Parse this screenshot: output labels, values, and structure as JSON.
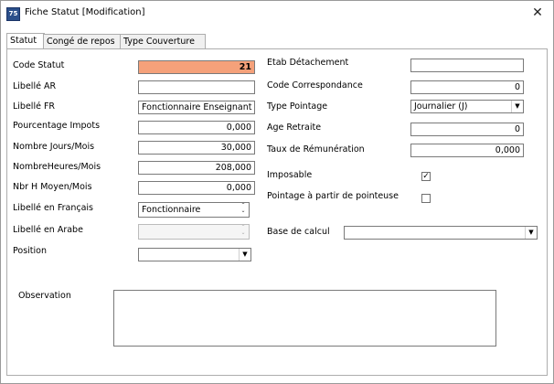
{
  "window": {
    "title": "Fiche Statut [Modification]",
    "icon_text": "75"
  },
  "tabs": [
    "Statut",
    "Congé de repos",
    "Type Couverture"
  ],
  "left": {
    "code_statut": {
      "label": "Code Statut",
      "value": "21"
    },
    "libelle_ar": {
      "label": "Libellé AR",
      "value": ""
    },
    "libelle_fr": {
      "label": "Libellé FR",
      "value": "Fonctionnaire Enseignant"
    },
    "pourcentage_impots": {
      "label": "Pourcentage Impots",
      "value": "0,000"
    },
    "nombre_jours_mois": {
      "label": "Nombre Jours/Mois",
      "value": "30,000"
    },
    "nombre_heures_mois": {
      "label": "NombreHeures/Mois",
      "value": "208,000"
    },
    "nbr_h_moyen_mois": {
      "label": "Nbr H Moyen/Mois",
      "value": "0,000"
    },
    "libelle_en_francais": {
      "label": "Libellé en Français",
      "value": "Fonctionnaire"
    },
    "libelle_en_arabe": {
      "label": "Libellé en Arabe",
      "value": ""
    },
    "position": {
      "label": "Position",
      "value": ""
    }
  },
  "right": {
    "etab_detachement": {
      "label": "Etab Détachement",
      "value": ""
    },
    "code_correspondance": {
      "label": "Code Correspondance",
      "value": "0"
    },
    "type_pointage": {
      "label": "Type Pointage",
      "value": "Journalier (J)"
    },
    "age_retraite": {
      "label": "Age Retraite",
      "value": "0"
    },
    "taux_remuneration": {
      "label": "Taux de Rémunération",
      "value": "0,000"
    },
    "imposable": {
      "label": "Imposable",
      "checked": true
    },
    "pointage_pointeuse": {
      "label": "Pointage à partir de pointeuse",
      "checked": false
    },
    "base_calcul": {
      "label": "Base de calcul",
      "value": ""
    }
  },
  "observation": {
    "label": "Observation",
    "value": ""
  },
  "colors": {
    "code_statut_bg": "#f5a17a",
    "icon_bg": "#2b4f8a"
  }
}
